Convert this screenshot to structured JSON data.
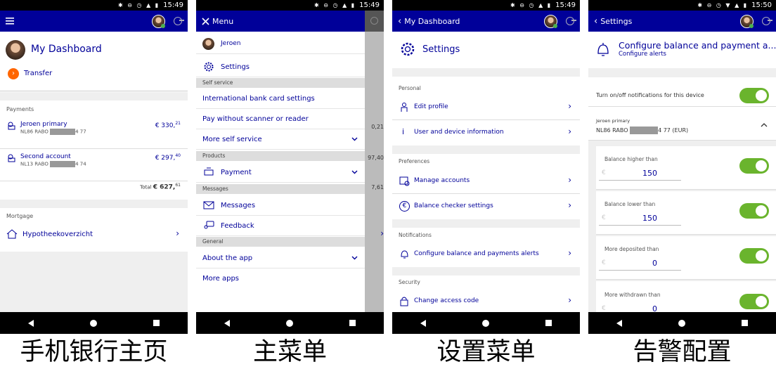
{
  "screens": [
    {
      "status_time": "15:49",
      "caption": "手机银行主页",
      "title": "My Dashboard",
      "transfer_label": "Transfer",
      "payments_label": "Payments",
      "accounts": [
        {
          "name": "Jeroen primary",
          "iban_prefix": "NL86 RABO",
          "iban_suffix": "4 77",
          "amount_main": "€ 330,",
          "amount_cents": "21"
        },
        {
          "name": "Second account",
          "iban_prefix": "NL13 RABO",
          "iban_suffix": "4 74",
          "amount_main": "€ 297,",
          "amount_cents": "40"
        }
      ],
      "total_label": "Total",
      "total_main": "€ 627,",
      "total_cents": "61",
      "mortgage_label": "Mortgage",
      "mortgage_item": "Hypotheekoverzicht"
    },
    {
      "status_time": "15:49",
      "caption": "主菜单",
      "menu_title": "Menu",
      "user": "Jeroen",
      "settings": "Settings",
      "self_service_label": "Self service",
      "intl_card": "International bank card settings",
      "pay_without": "Pay without scanner or reader",
      "more_self": "More self service",
      "products_label": "Products",
      "payment": "Payment",
      "messages_label": "Messages",
      "messages": "Messages",
      "feedback": "Feedback",
      "general_label": "General",
      "about": "About the app",
      "more_apps": "More apps",
      "peek": [
        "0,21",
        "97,40",
        "7,61"
      ]
    },
    {
      "status_time": "15:49",
      "caption": "设置菜单",
      "back_label": "My Dashboard",
      "title": "Settings",
      "personal_label": "Personal",
      "edit_profile": "Edit profile",
      "user_device": "User and device information",
      "preferences_label": "Preferences",
      "manage_accounts": "Manage accounts",
      "balance_checker": "Balance checker settings",
      "notifications_label": "Notifications",
      "configure_alerts": "Configure balance and payments alerts",
      "security_label": "Security",
      "change_code": "Change access code"
    },
    {
      "status_time": "15:50",
      "caption": "告警配置",
      "back_label": "Settings",
      "title": "Configure balance and payment a...",
      "subtitle": "Configure alerts",
      "toggle_device": "Turn on/off notifications for this device",
      "account_name": "Jeroen primary",
      "iban_prefix": "NL86 RABO",
      "iban_suffix": "4 77 (EUR)",
      "rules": [
        {
          "label": "Balance higher than",
          "value": "150"
        },
        {
          "label": "Balance lower than",
          "value": "150"
        },
        {
          "label": "More deposited than",
          "value": "0"
        },
        {
          "label": "More withdrawn than",
          "value": "0"
        }
      ],
      "currency_symbol": "€"
    }
  ],
  "colors": {
    "brand_blue": "#000099",
    "accent_orange": "#ff6600",
    "toggle_green": "#6ab42d"
  }
}
